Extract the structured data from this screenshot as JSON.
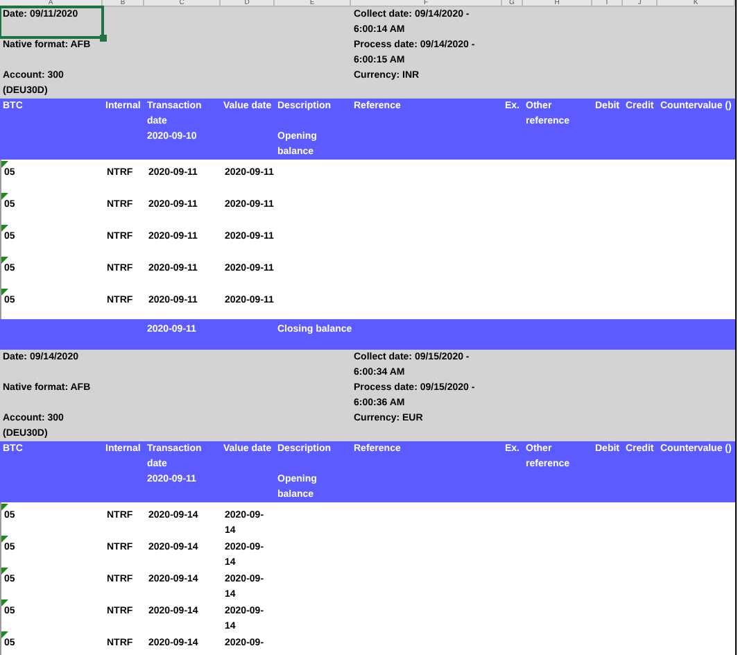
{
  "column_headers": [
    "A",
    "B",
    "C",
    "D",
    "E",
    "F",
    "G",
    "H",
    "I",
    "J",
    "K"
  ],
  "statements": [
    {
      "info_left": [
        {
          "text": "Date: 09/11/2020",
          "selected": true
        },
        {
          "text": "Native format: AFB",
          "selected": false
        },
        {
          "text": "Account: 300",
          "selected": false
        },
        {
          "text": "(DEU30D)",
          "selected": false
        }
      ],
      "info_right": [
        "Collect date: 09/14/2020 -",
        "6:00:14 AM",
        "Process date: 09/14/2020 -",
        "6:00:15 AM",
        "Currency: INR"
      ],
      "columns": [
        "BTC",
        "Internal",
        "Transaction date",
        "Value date",
        "Description",
        "Reference",
        "Ex.",
        "Other reference",
        "Debit",
        "Credit",
        "Countervalue ()"
      ],
      "opening_date": "2020-09-10",
      "opening_label": "Opening balance",
      "rows": [
        {
          "btc": "05",
          "flagged": true,
          "internal": "NTRF",
          "transaction_date": "2020-09-11",
          "value_date": "2020-09-11",
          "wrap": false
        },
        {
          "btc": "05",
          "flagged": true,
          "internal": "NTRF",
          "transaction_date": "2020-09-11",
          "value_date": "2020-09-11",
          "wrap": false
        },
        {
          "btc": "05",
          "flagged": true,
          "internal": "NTRF",
          "transaction_date": "2020-09-11",
          "value_date": "2020-09-11",
          "wrap": false
        },
        {
          "btc": "05",
          "flagged": true,
          "internal": "NTRF",
          "transaction_date": "2020-09-11",
          "value_date": "2020-09-11",
          "wrap": false
        },
        {
          "btc": "05",
          "flagged": true,
          "internal": "NTRF",
          "transaction_date": "2020-09-11",
          "value_date": "2020-09-11",
          "wrap": false
        }
      ],
      "closing_date": "2020-09-11",
      "closing_label": "Closing balance"
    },
    {
      "info_left": [
        {
          "text": "Date: 09/14/2020",
          "selected": false
        },
        {
          "text": "Native format: AFB",
          "selected": false
        },
        {
          "text": "Account: 300",
          "selected": false
        },
        {
          "text": "(DEU30D)",
          "selected": false
        }
      ],
      "info_right": [
        "Collect date: 09/15/2020 -",
        "6:00:34 AM",
        "Process date: 09/15/2020 -",
        "6:00:36 AM",
        "Currency: EUR"
      ],
      "columns": [
        "BTC",
        "Internal",
        "Transaction date",
        "Value date",
        "Description",
        "Reference",
        "Ex.",
        "Other reference",
        "Debit",
        "Credit",
        "Countervalue ()"
      ],
      "opening_date": "2020-09-11",
      "opening_label": "Opening balance",
      "rows": [
        {
          "btc": "05",
          "flagged": true,
          "internal": "NTRF",
          "transaction_date": "2020-09-14",
          "value_date": "2020-09-14",
          "wrap": true
        },
        {
          "btc": "05",
          "flagged": true,
          "internal": "NTRF",
          "transaction_date": "2020-09-14",
          "value_date": "2020-09-14",
          "wrap": true
        },
        {
          "btc": "05",
          "flagged": true,
          "internal": "NTRF",
          "transaction_date": "2020-09-14",
          "value_date": "2020-09-14",
          "wrap": true
        },
        {
          "btc": "05",
          "flagged": true,
          "internal": "NTRF",
          "transaction_date": "2020-09-14",
          "value_date": "2020-09-14",
          "wrap": true
        },
        {
          "btc": "05",
          "flagged": true,
          "internal": "NTRF",
          "transaction_date": "2020-09-14",
          "value_date": "2020-09-",
          "wrap": false
        }
      ]
    }
  ]
}
